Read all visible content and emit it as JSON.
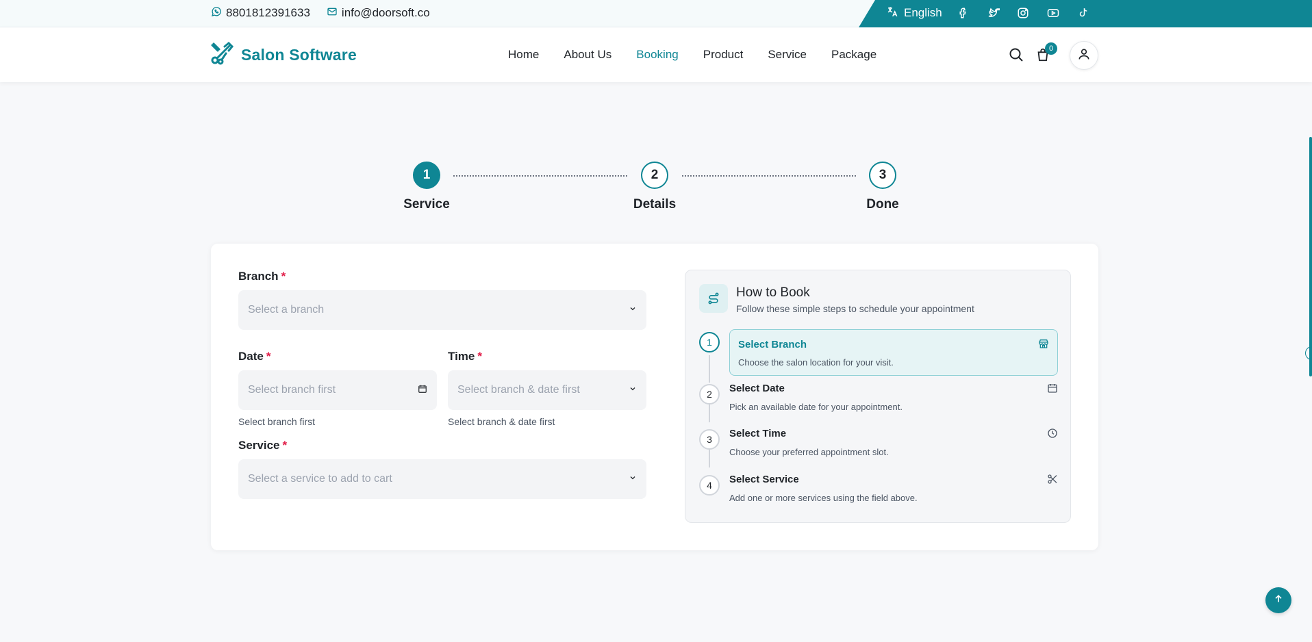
{
  "topbar": {
    "phone": "8801812391633",
    "email": "info@doorsoft.co",
    "language": "English",
    "social_icons": [
      "facebook-icon",
      "twitter-icon",
      "instagram-icon",
      "youtube-icon",
      "tiktok-icon"
    ]
  },
  "header": {
    "brand": "Salon Software",
    "nav": [
      {
        "label": "Home",
        "active": false
      },
      {
        "label": "About Us",
        "active": false
      },
      {
        "label": "Booking",
        "active": true
      },
      {
        "label": "Product",
        "active": false
      },
      {
        "label": "Service",
        "active": false
      },
      {
        "label": "Package",
        "active": false
      }
    ],
    "cart_count": "0"
  },
  "stepper": {
    "steps": [
      {
        "number": "1",
        "label": "Service",
        "active": true
      },
      {
        "number": "2",
        "label": "Details",
        "active": false
      },
      {
        "number": "3",
        "label": "Done",
        "active": false
      }
    ]
  },
  "form": {
    "branch_label": "Branch",
    "branch_placeholder": "Select a branch",
    "date_label": "Date",
    "date_placeholder": "Select branch first",
    "date_helper": "Select branch first",
    "time_label": "Time",
    "time_placeholder": "Select branch & date first",
    "time_helper": "Select branch & date first",
    "service_label": "Service",
    "service_placeholder": "Select a service to add to cart",
    "required_mark": "*"
  },
  "how_to_book": {
    "title": "How to Book",
    "subtitle": "Follow these simple steps to schedule your appointment",
    "steps": [
      {
        "number": "1",
        "title": "Select Branch",
        "description": "Choose the salon location for your visit.",
        "icon": "store-icon",
        "active": true
      },
      {
        "number": "2",
        "title": "Select Date",
        "description": "Pick an available date for your appointment.",
        "icon": "calendar-icon",
        "active": false
      },
      {
        "number": "3",
        "title": "Select Time",
        "description": "Choose your preferred appointment slot.",
        "icon": "clock-icon",
        "active": false
      },
      {
        "number": "4",
        "title": "Select Service",
        "description": "Add one or more services using the field above.",
        "icon": "scissors-icon",
        "active": false
      }
    ]
  },
  "colors": {
    "accent": "#0f8694",
    "required": "#e11d48",
    "placeholder": "#9ca3af"
  }
}
